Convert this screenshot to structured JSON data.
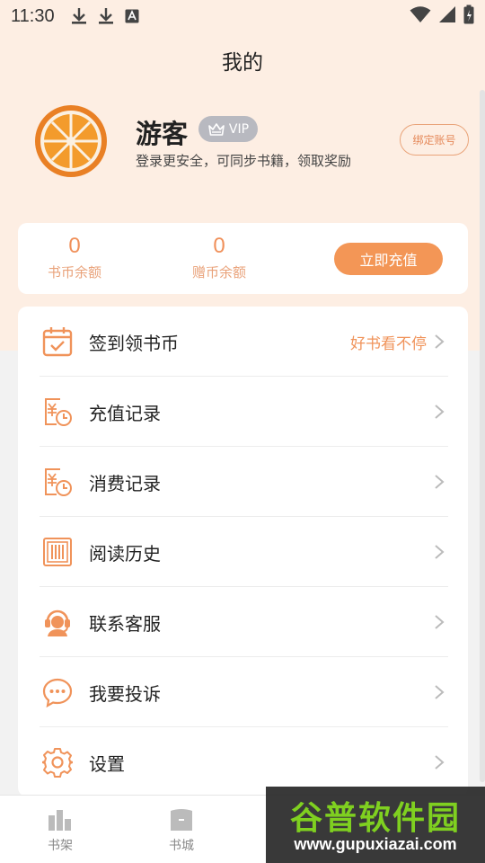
{
  "status_bar": {
    "time": "11:30"
  },
  "header": {
    "title": "我的"
  },
  "profile": {
    "username": "游客",
    "vip_label": "VIP",
    "subtitle": "登录更安全，可同步书籍，领取奖励",
    "bind_label": "绑定账号"
  },
  "wallet": {
    "book_coins": {
      "value": "0",
      "label": "书币余额"
    },
    "gift_coins": {
      "value": "0",
      "label": "赠币余额"
    },
    "recharge_label": "立即充值"
  },
  "menu": [
    {
      "label": "签到领书币",
      "extra": "好书看不停",
      "icon": "calendar-check-icon"
    },
    {
      "label": "充值记录",
      "extra": "",
      "icon": "recharge-record-icon"
    },
    {
      "label": "消费记录",
      "extra": "",
      "icon": "consume-record-icon"
    },
    {
      "label": "阅读历史",
      "extra": "",
      "icon": "reading-history-icon"
    },
    {
      "label": "联系客服",
      "extra": "",
      "icon": "customer-service-icon"
    },
    {
      "label": "我要投诉",
      "extra": "",
      "icon": "complaint-chat-icon"
    },
    {
      "label": "设置",
      "extra": "",
      "icon": "gear-icon"
    }
  ],
  "bottom_nav": [
    {
      "label": "书架",
      "icon": "bookshelf-icon"
    },
    {
      "label": "书城",
      "icon": "bookstore-icon"
    }
  ],
  "watermark": {
    "title": "谷普软件园",
    "url": "www.gupuxiazai.com"
  },
  "colors": {
    "accent": "#f39656",
    "header_bg": "#fdeee3",
    "page_bg": "#f2f2f2"
  }
}
